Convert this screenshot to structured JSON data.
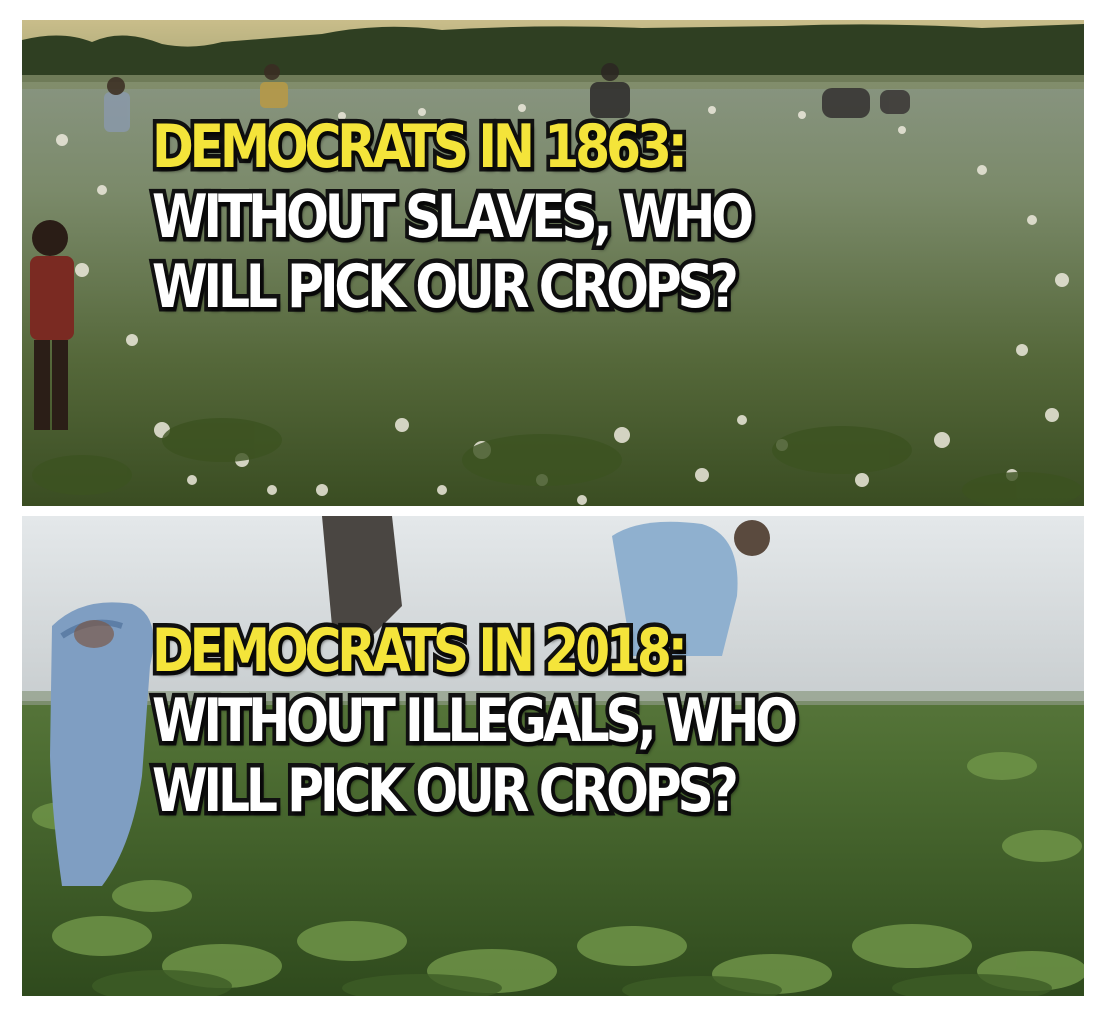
{
  "panels": [
    {
      "scene": "cotton field",
      "headline": "DEMOCRATS IN 1863:",
      "lines": [
        "WITHOUT SLAVES, WHO",
        "WILL PICK OUR CROPS?"
      ],
      "colors": {
        "headline": "#f4e43a",
        "body": "#ffffff"
      }
    },
    {
      "scene": "vegetable field",
      "headline": "DEMOCRATS IN 2018:",
      "lines": [
        "WITHOUT ILLEGALS, WHO",
        "WILL PICK OUR CROPS?"
      ],
      "colors": {
        "headline": "#f4e43a",
        "body": "#ffffff"
      }
    }
  ]
}
